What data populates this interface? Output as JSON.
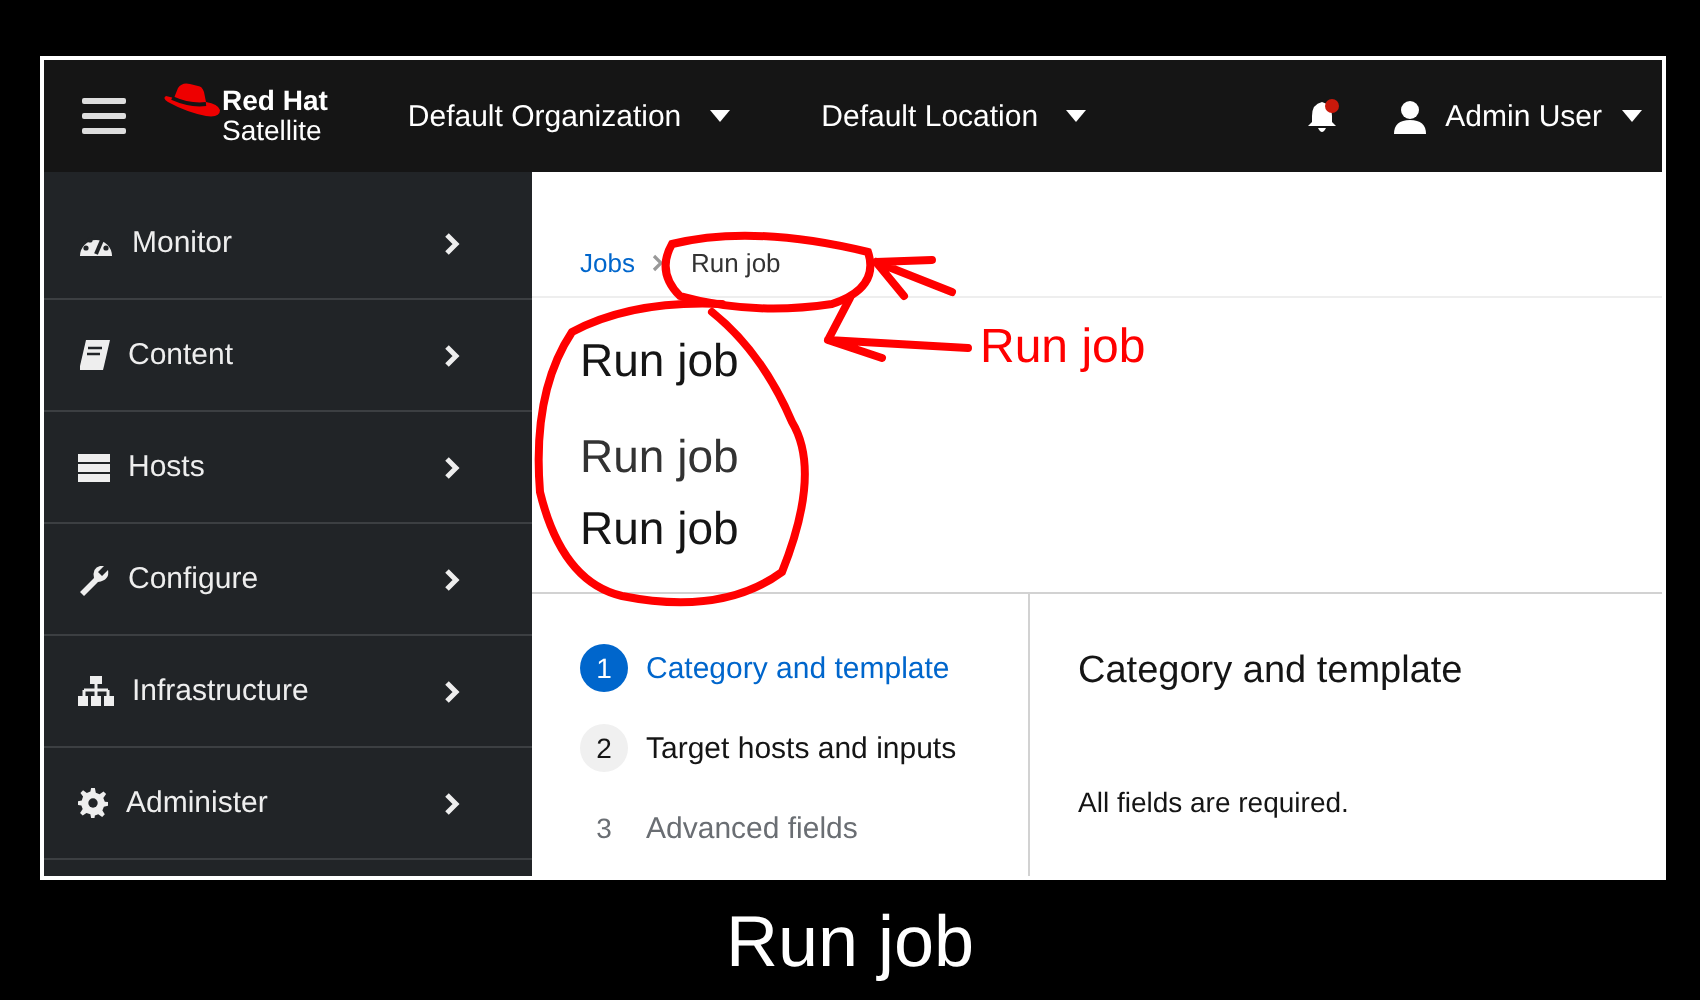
{
  "header": {
    "logo": {
      "line1": "Red Hat",
      "line2": "Satellite"
    },
    "organization": "Default Organization",
    "location": "Default Location",
    "notification_unread": true,
    "user": "Admin User"
  },
  "sidebar": {
    "items": [
      {
        "label": "Monitor"
      },
      {
        "label": "Content"
      },
      {
        "label": "Hosts"
      },
      {
        "label": "Configure"
      },
      {
        "label": "Infrastructure"
      },
      {
        "label": "Administer"
      }
    ]
  },
  "breadcrumb": [
    {
      "label": "Jobs",
      "link": true
    },
    {
      "label": "Run job",
      "link": false
    }
  ],
  "headings": [
    "Run job",
    "Run job",
    "Run job"
  ],
  "annotation": {
    "label": "Run job"
  },
  "wizard": {
    "steps": [
      {
        "number": "1",
        "label": "Category and template",
        "selected": true,
        "disabled": false
      },
      {
        "number": "2",
        "label": "Target hosts and inputs",
        "selected": false,
        "disabled": false
      },
      {
        "number": "3",
        "label": "Advanced fields",
        "selected": false,
        "disabled": true
      }
    ],
    "panel": {
      "title": "Category and template",
      "note": "All fields are required."
    }
  },
  "caption": "Run job"
}
